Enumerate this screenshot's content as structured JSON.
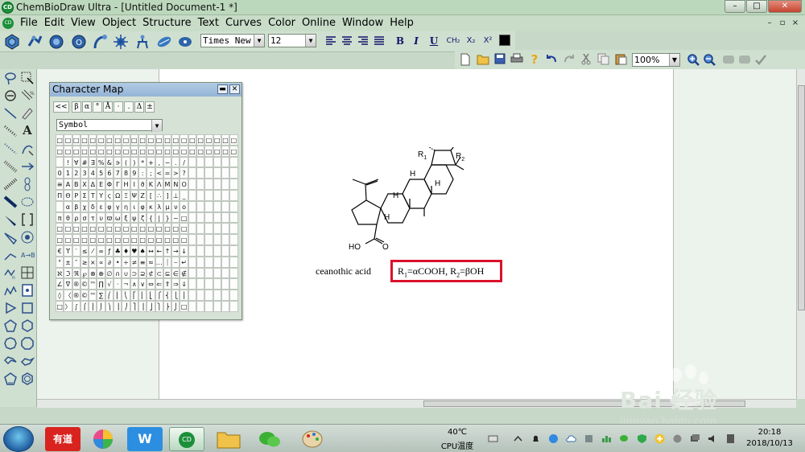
{
  "window": {
    "title": "ChemBioDraw Ultra - [Untitled Document-1 *]",
    "app_icon": "CD",
    "controls": [
      "–",
      "□",
      "✕"
    ]
  },
  "menubar": {
    "items": [
      "File",
      "Edit",
      "View",
      "Object",
      "Structure",
      "Text",
      "Curves",
      "Color",
      "Online",
      "Window",
      "Help"
    ],
    "mdi_controls": [
      "–",
      "▫",
      "×"
    ]
  },
  "format_toolbar": {
    "font": "Times New R",
    "size": "12",
    "bold": "B",
    "italic": "I",
    "underline": "U",
    "chem_formula": "CH₂",
    "subscript": "X₂",
    "superscript": "X²",
    "color": "#000000"
  },
  "standard_toolbar": {
    "zoom": "100%"
  },
  "character_map": {
    "title": "Character Map",
    "back_label": "<<",
    "recent": [
      "β",
      "α",
      "°",
      "Å",
      "·",
      ".",
      "Δ",
      "±"
    ],
    "font": "Symbol",
    "rows": [
      [
        "□",
        "□",
        "□",
        "□",
        "□",
        "□",
        "□",
        "□",
        "□",
        "□",
        "□",
        "□",
        "□",
        "□",
        "□",
        "□",
        "□",
        "□",
        "□",
        "□",
        "□",
        "□"
      ],
      [
        "□",
        "□",
        "□",
        "□",
        "□",
        "□",
        "□",
        "□",
        "□",
        "□",
        "□",
        "□",
        "□",
        "□",
        "□",
        "□",
        "□",
        "□",
        "□",
        "□",
        "□",
        "□"
      ],
      [
        "",
        "!",
        "∀",
        "#",
        "∃",
        "%",
        "&",
        "∍",
        "(",
        ")",
        "*",
        "+",
        ",",
        "−",
        ".",
        "/",
        "",
        "",
        "",
        "",
        "",
        ""
      ],
      [
        "0",
        "1",
        "2",
        "3",
        "4",
        "5",
        "6",
        "7",
        "8",
        "9",
        ":",
        ";",
        "<",
        "=",
        ">",
        "?",
        "",
        "",
        "",
        "",
        "",
        ""
      ],
      [
        "≅",
        "Α",
        "Β",
        "Χ",
        "Δ",
        "Ε",
        "Φ",
        "Γ",
        "Η",
        "Ι",
        "ϑ",
        "Κ",
        "Λ",
        "Μ",
        "Ν",
        "Ο",
        "",
        "",
        "",
        "",
        "",
        ""
      ],
      [
        "Π",
        "Θ",
        "Ρ",
        "Σ",
        "Τ",
        "Υ",
        "ς",
        "Ω",
        "Ξ",
        "Ψ",
        "Ζ",
        "[",
        "∴",
        "]",
        "⊥",
        "_",
        "",
        "",
        "",
        "",
        "",
        ""
      ],
      [
        "",
        "α",
        "β",
        "χ",
        "δ",
        "ε",
        "φ",
        "γ",
        "η",
        "ι",
        "φ",
        "κ",
        "λ",
        "μ",
        "ν",
        "ο",
        "",
        "",
        "",
        "",
        "",
        ""
      ],
      [
        "π",
        "θ",
        "ρ",
        "σ",
        "τ",
        "υ",
        "ϖ",
        "ω",
        "ξ",
        "ψ",
        "ζ",
        "{",
        "|",
        "}",
        "~",
        "□",
        "",
        "",
        "",
        "",
        "",
        ""
      ],
      [
        "□",
        "□",
        "□",
        "□",
        "□",
        "□",
        "□",
        "□",
        "□",
        "□",
        "□",
        "□",
        "□",
        "□",
        "□",
        "□",
        "",
        "",
        "",
        "",
        "",
        ""
      ],
      [
        "□",
        "□",
        "□",
        "□",
        "□",
        "□",
        "□",
        "□",
        "□",
        "□",
        "□",
        "□",
        "□",
        "□",
        "□",
        "□",
        "",
        "",
        "",
        "",
        "",
        ""
      ],
      [
        "€",
        "ϒ",
        "′",
        "≤",
        "⁄",
        "∞",
        "ƒ",
        "♣",
        "♦",
        "♥",
        "♠",
        "↔",
        "←",
        "↑",
        "→",
        "↓",
        "",
        "",
        "",
        "",
        "",
        ""
      ],
      [
        "°",
        "±",
        "″",
        "≥",
        "×",
        "∝",
        "∂",
        "•",
        "÷",
        "≠",
        "≡",
        "≈",
        "…",
        "⏐",
        "⎯",
        "↵",
        "",
        "",
        "",
        "",
        "",
        ""
      ],
      [
        "ℵ",
        "ℑ",
        "ℜ",
        "℘",
        "⊗",
        "⊕",
        "∅",
        "∩",
        "∪",
        "⊃",
        "⊇",
        "⊄",
        "⊂",
        "⊆",
        "∈",
        "∉",
        "",
        "",
        "",
        "",
        "",
        ""
      ],
      [
        "∠",
        "∇",
        "®",
        "©",
        "™",
        "∏",
        "√",
        "⋅",
        "¬",
        "∧",
        "∨",
        "⇔",
        "⇐",
        "⇑",
        "⇒",
        "⇓",
        "",
        "",
        "",
        "",
        "",
        ""
      ],
      [
        "◊",
        "〈",
        "®",
        "©",
        "™",
        "∑",
        "⎛",
        "⎜",
        "⎝",
        "⎡",
        "⎢",
        "⎣",
        "⎧",
        "⎨",
        "⎩",
        "⎪",
        "",
        "",
        "",
        "",
        "",
        ""
      ],
      [
        "□",
        "〉",
        "∫",
        "⌠",
        "⎮",
        "⌡",
        "⎞",
        "⎟",
        "⎠",
        "⎤",
        "⎥",
        "⎦",
        "⎫",
        "⎬",
        "⎭",
        "□",
        "",
        "",
        "",
        "",
        "",
        ""
      ]
    ]
  },
  "drawing": {
    "structure_labels": {
      "r1": "R",
      "r1_sub": "1",
      "r2": "R",
      "r2_sub": "2",
      "h_top_left": "H",
      "h_top_right": "H",
      "h_mid": "H",
      "h_bottom": "H",
      "carboxyl": "HO",
      "oxygen": "O"
    },
    "caption_name": "ceanothic acid",
    "caption_r1": "R",
    "caption_r1_sub": "1",
    "caption_r1_val": "=αCOOH, R",
    "caption_r2_sub": "2",
    "caption_r2_val": "=βOH",
    "highlight_color": "#d9112a"
  },
  "taskbar": {
    "youdao_label": "有道",
    "temperature": "40℃",
    "cpu_label": "CPU温度",
    "time": "20:18",
    "date": "2018/10/13"
  },
  "watermark": {
    "line1": "Bai 经验",
    "line2": "jingyan.baidu.com"
  }
}
